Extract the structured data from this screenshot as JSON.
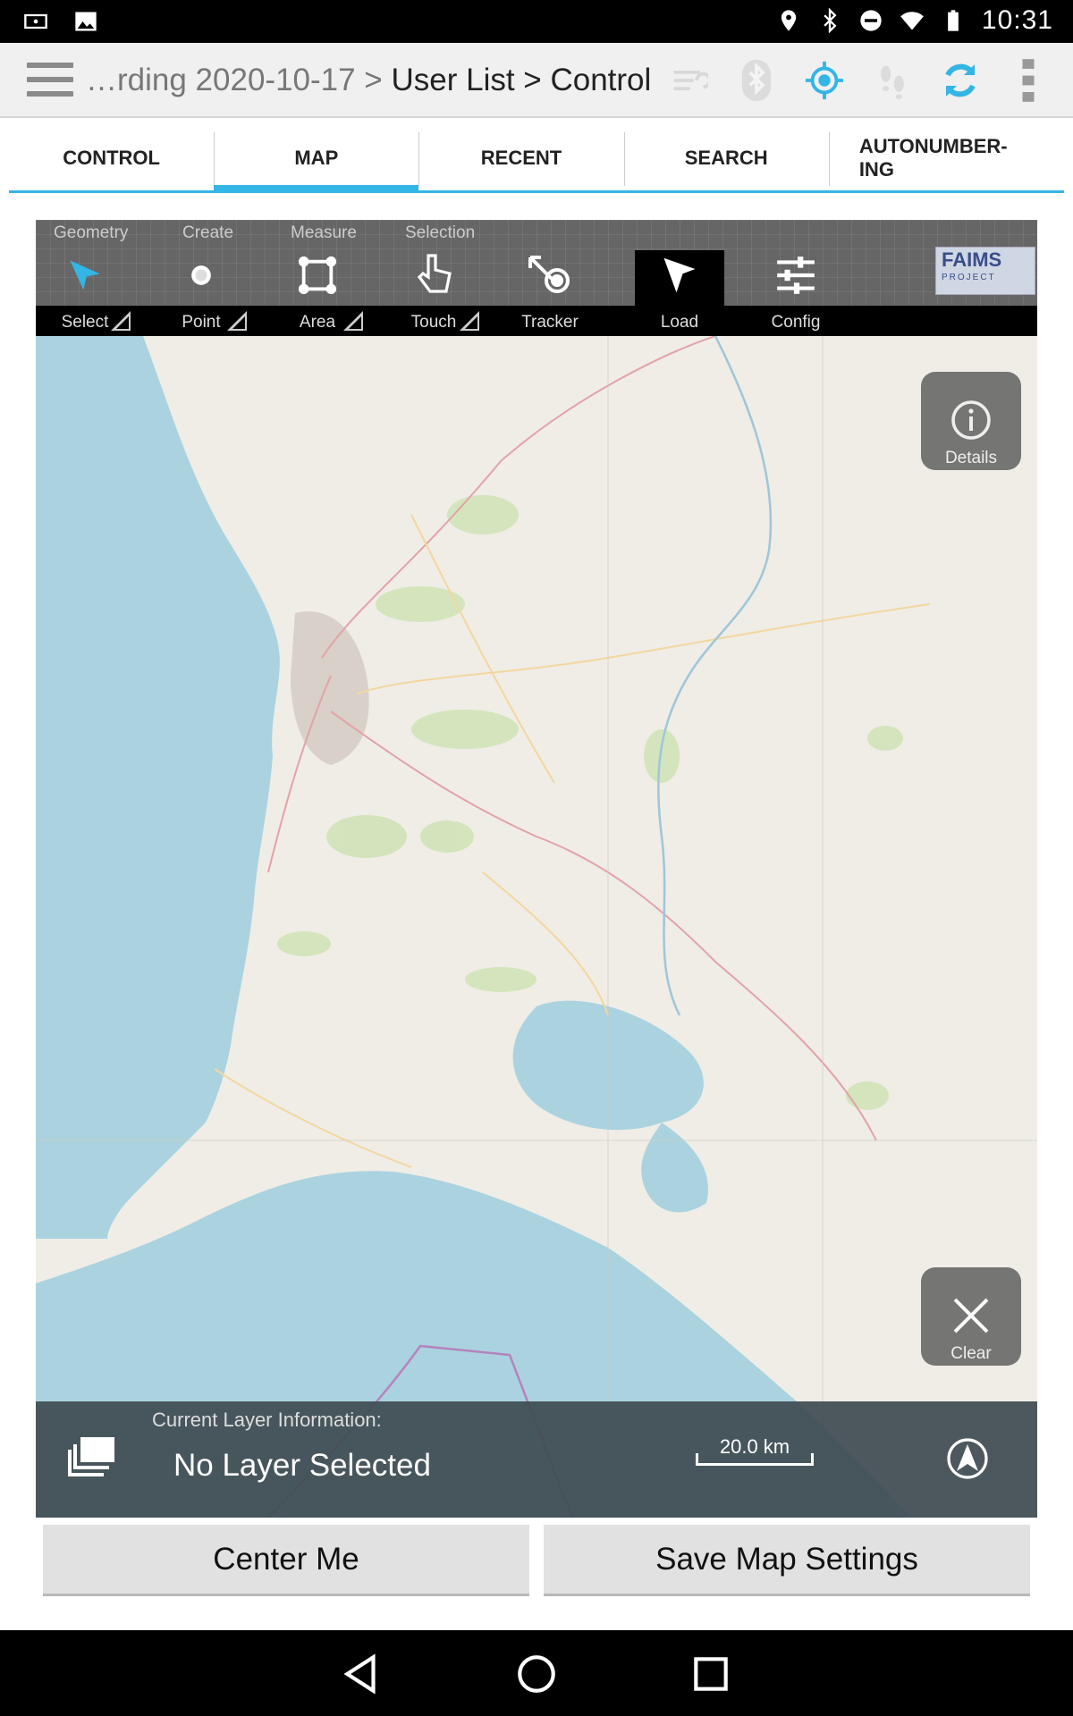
{
  "status_bar": {
    "time": "10:31",
    "icons": [
      "cast-icon",
      "image-icon",
      "location-icon",
      "bluetooth-icon",
      "dnd-icon",
      "wifi-icon",
      "battery-icon"
    ]
  },
  "action_bar": {
    "breadcrumb_dim": "…rding 2020-10-17 > ",
    "breadcrumb_main": "User List > Control",
    "icons": [
      "sync-disabled-icon",
      "bluetooth-disabled-icon",
      "gps-icon",
      "tracker-disabled-icon",
      "sync-icon",
      "overflow-menu-icon"
    ],
    "accent": "#33b5e5"
  },
  "tabs": [
    {
      "label": "CONTROL"
    },
    {
      "label": "MAP",
      "active": true
    },
    {
      "label": "RECENT"
    },
    {
      "label": "SEARCH"
    },
    {
      "label": "AUTONUMBER-\nING"
    }
  ],
  "toolbar": {
    "groups": [
      "Geometry",
      "Create",
      "Measure",
      "Selection"
    ],
    "tools": [
      {
        "label": "Select",
        "icon": "select-arrow-icon"
      },
      {
        "label": "Point",
        "icon": "point-icon"
      },
      {
        "label": "Area",
        "icon": "area-icon"
      },
      {
        "label": "Touch",
        "icon": "touch-icon"
      },
      {
        "label": "Tracker",
        "icon": "tracker-icon"
      },
      {
        "label": "Load",
        "icon": "load-arrow-icon"
      },
      {
        "label": "Config",
        "icon": "config-sliders-icon"
      }
    ],
    "logo_text": "FAIMS",
    "logo_sub": "PROJECT"
  },
  "map": {
    "details_label": "Details",
    "clear_label": "Clear",
    "layer_info_label": "Current Layer Information:",
    "layer_value": "No Layer Selected",
    "scale_label": "20.0 km"
  },
  "buttons": {
    "center": "Center Me",
    "save": "Save Map Settings"
  }
}
